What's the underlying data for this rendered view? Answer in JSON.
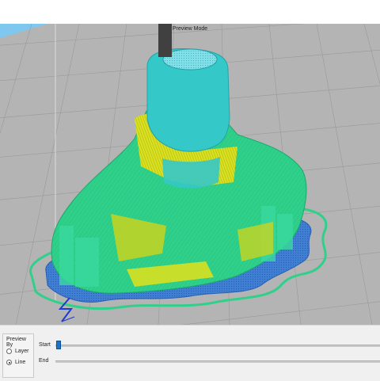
{
  "viewport": {
    "mode_label": "Preview Mode",
    "axis_label": "Z"
  },
  "preview_by": {
    "title": "Preview By",
    "options": [
      {
        "label": "Layer",
        "selected": false
      },
      {
        "label": "Line",
        "selected": true
      }
    ]
  },
  "sliders": {
    "start_label": "Start",
    "end_label": "End",
    "start_value": 0,
    "end_value": 1
  },
  "colors": {
    "build_plate": "#b4b4b4",
    "grid": "#9c9c9c",
    "model_outer": "#2fd08a",
    "model_upper": "#34c8c8",
    "model_infill": "#d8e020",
    "brim": "#2f7fd0",
    "accent": "#1f73c9"
  },
  "icons": [
    "z-axis-icon",
    "nozzle-icon"
  ]
}
